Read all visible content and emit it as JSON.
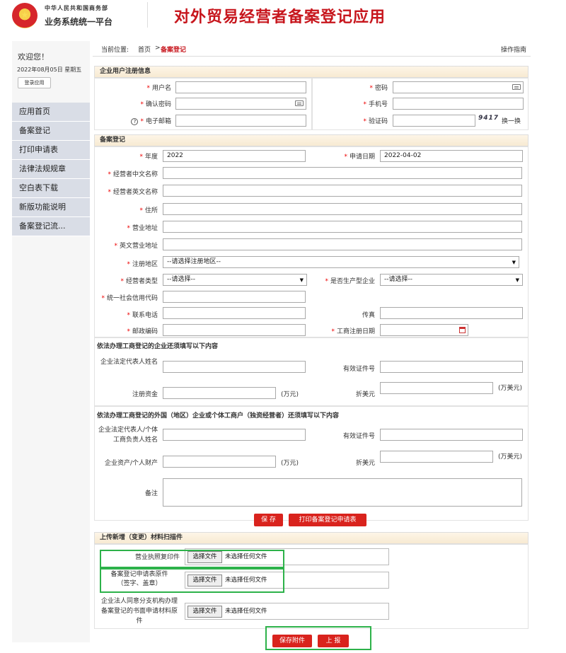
{
  "header": {
    "org_line1": "中华人民共和国商务部",
    "org_line2": "业务系统统一平台",
    "app_title": "对外贸易经营者备案登记应用"
  },
  "sidebar": {
    "welcome": "欢迎您！",
    "date": "2022年08月05日 星期五",
    "login_app": "登录应用",
    "items": [
      {
        "label": "应用首页"
      },
      {
        "label": "备案登记"
      },
      {
        "label": "打印申请表"
      },
      {
        "label": "法律法规规章"
      },
      {
        "label": "空白表下载"
      },
      {
        "label": "新版功能说明"
      },
      {
        "label": "备案登记流..."
      }
    ]
  },
  "breadcrumb": {
    "prefix": "当前位置:",
    "home": "首页",
    "sep": ">",
    "current": "备案登记",
    "guide": "操作指南"
  },
  "required_mark": "*",
  "reg": {
    "title": "企业用户注册信息",
    "username": "用户名",
    "password": "密码",
    "confirm": "确认密码",
    "mobile": "手机号",
    "email": "电子邮箱",
    "captcha": "验证码",
    "captcha_code": "9417",
    "refresh": "换一换",
    "help": "?"
  },
  "filing": {
    "title": "备案登记",
    "year": "年度",
    "year_value": "2022",
    "apply_date": "申请日期",
    "apply_date_value": "2022-04-02",
    "cn_name": "经营者中文名称",
    "en_name": "经营者英文名称",
    "address": "住所",
    "biz_addr": "营业地址",
    "en_biz_addr": "英文营业地址",
    "region": "注册地区",
    "region_value": "--请选择注册地区--",
    "type": "经营者类型",
    "type_value": "--请选择--",
    "production": "是否生产型企业",
    "production_value": "--请选择--",
    "credit_code": "统一社会信用代码",
    "phone": "联系电话",
    "fax": "传真",
    "postcode": "邮政编码",
    "ic_date": "工商注册日期",
    "sub1": "依法办理工商登记的企业还须填写以下内容",
    "legal_rep": "企业法定代表人姓名",
    "cert_no": "有效证件号",
    "reg_capital": "注册资金",
    "unit_wan": "(万元)",
    "usd": "折美元",
    "unit_usd": "(万美元)",
    "sub2": "依法办理工商登记的外国（地区）企业或个体工商户（独资经营者）还须填写以下内容",
    "rep2": "企业法定代表人/个体工商负责人姓名",
    "cert2": "有效证件号",
    "assets": "企业资产/个人财产",
    "unit_wan2": "(万元)",
    "usd2": "折美元",
    "unit_usd2": "(万美元)",
    "remark": "备注"
  },
  "actions": {
    "save": "保 存",
    "print": "打印备案登记申请表"
  },
  "upload": {
    "title": "上传新增（变更）材料扫描件",
    "row1": "营业执照复印件",
    "row2": "备案登记申请表原件\n（签字、盖章）",
    "row3": "企业法人同意分支机构办理备案登记的书面申请材料原件",
    "choose": "选择文件",
    "none": "未选择任何文件",
    "save_attach": "保存附件",
    "submit": "上 报"
  },
  "colors": {
    "accent": "#c7161d",
    "highlight_box": "#2db24a",
    "nav_bg": "#d9dde6"
  }
}
